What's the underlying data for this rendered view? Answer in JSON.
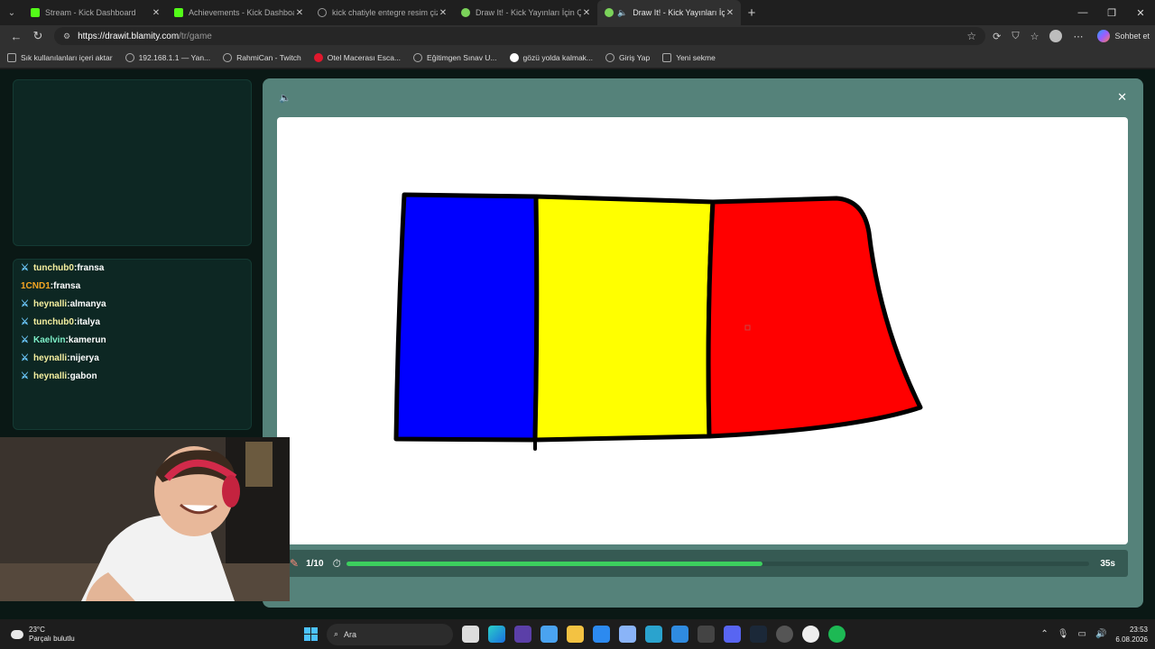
{
  "browser": {
    "tabs": [
      {
        "label": "Stream - Kick Dashboard",
        "icon": "kick-icon"
      },
      {
        "label": "Achievements - Kick Dashboard",
        "icon": "kick-icon"
      },
      {
        "label": "kick chatiyle entegre resim çizme",
        "icon": "globe-icon"
      },
      {
        "label": "Draw It! - Kick Yayınları İçin Çizim",
        "icon": "draw-icon"
      },
      {
        "label": "Draw It! - Kick Yayınları İçin Çi",
        "icon": "draw-icon",
        "active": true
      }
    ],
    "url_host": "https://drawit.blamity.com",
    "url_path": "/tr/game",
    "copilot_label": "Sohbet et",
    "bookmarks": [
      "Sık kullanılanları içeri aktar",
      "192.168.1.1 — Yan...",
      "RahmiCan - Twitch",
      "Otel Macerası Esca...",
      "Eğitimgen Sınav U...",
      "gözü yolda kalmak...",
      "Giriş Yap",
      "Yeni sekme"
    ]
  },
  "chat": {
    "messages": [
      {
        "user": "tunchub0",
        "text": "fransa",
        "badge": true,
        "color": "yellow"
      },
      {
        "user": "1CND1",
        "text": "fransa",
        "badge": false,
        "color": "orange"
      },
      {
        "user": "heynalli",
        "text": "almanya",
        "badge": true,
        "color": "yellow"
      },
      {
        "user": "tunchub0",
        "text": "italya",
        "badge": true,
        "color": "yellow"
      },
      {
        "user": "Kaelvin",
        "text": "kamerun",
        "badge": true,
        "color": "teal"
      },
      {
        "user": "heynalli",
        "text": "nijerya",
        "badge": true,
        "color": "yellow"
      },
      {
        "user": "heynalli",
        "text": "gabon",
        "badge": true,
        "color": "yellow"
      }
    ]
  },
  "game": {
    "round": "1/10",
    "time_left": "35s",
    "progress": 0.56,
    "drawing_colors": {
      "left": "#0000ff",
      "middle": "#ffff00",
      "right": "#ff0000"
    }
  },
  "taskbar": {
    "temperature": "23°C",
    "weather": "Parçalı bulutlu",
    "search_placeholder": "Ara",
    "time": "23:53",
    "date": "6.08.2026"
  }
}
